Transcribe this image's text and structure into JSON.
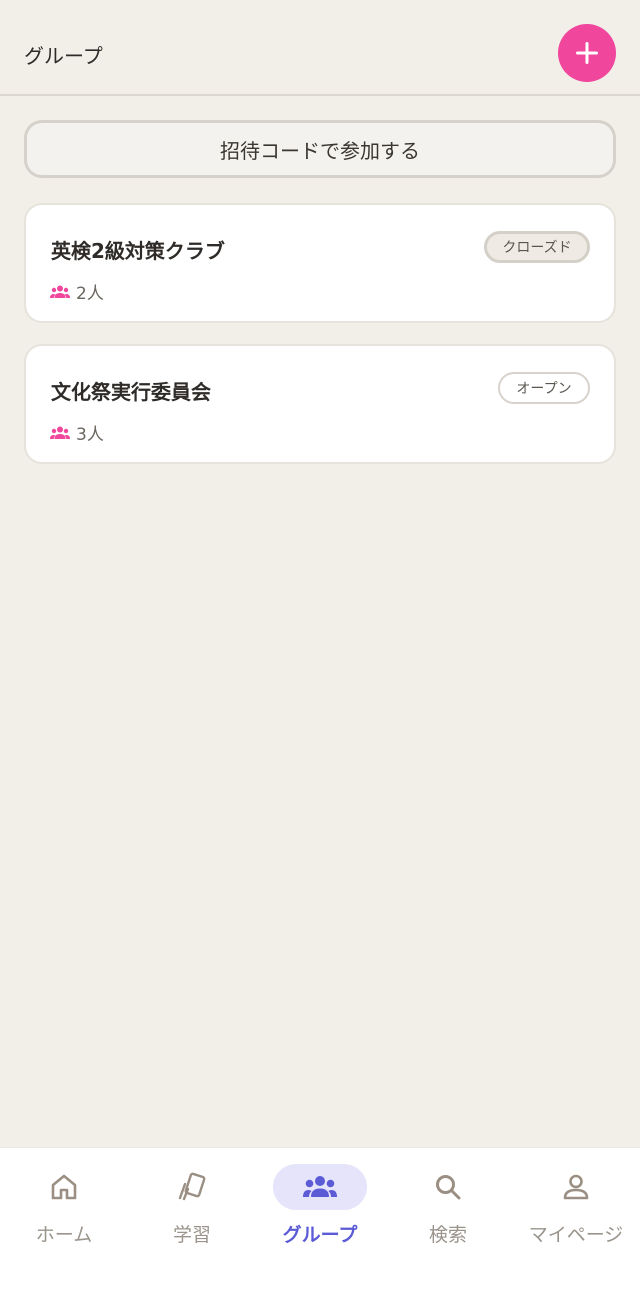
{
  "header": {
    "title": "グループ",
    "add_icon": "plus-icon"
  },
  "join": {
    "label": "招待コードで参加する"
  },
  "groups": [
    {
      "name": "英検2級対策クラブ",
      "status": "クローズド",
      "members": "2人"
    },
    {
      "name": "文化祭実行委員会",
      "status": "オープン",
      "members": "3人"
    }
  ],
  "nav": {
    "items": [
      {
        "label": "ホーム",
        "icon": "home-icon"
      },
      {
        "label": "学習",
        "icon": "cards-icon"
      },
      {
        "label": "グループ",
        "icon": "group-icon"
      },
      {
        "label": "検索",
        "icon": "search-icon"
      },
      {
        "label": "マイページ",
        "icon": "person-icon"
      }
    ],
    "active": "グループ"
  },
  "colors": {
    "accent_pink": "#f0469c",
    "accent_purple": "#5b5bd6",
    "background": "#f2efe9"
  }
}
